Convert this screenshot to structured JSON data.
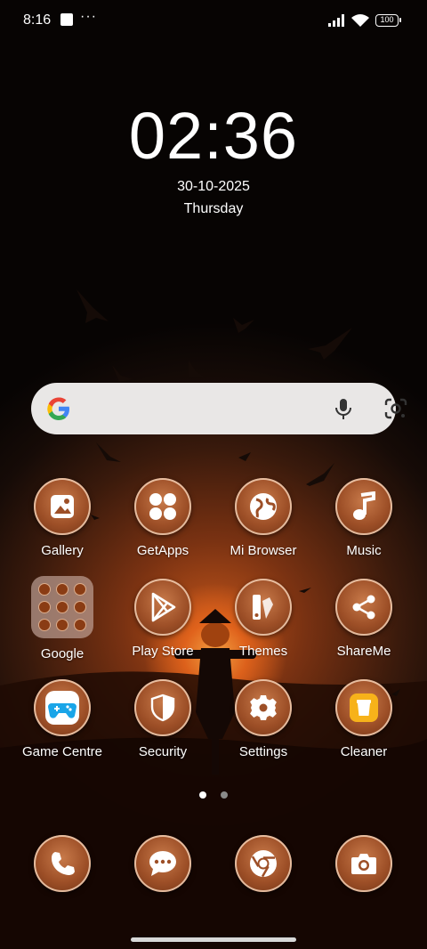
{
  "status_bar": {
    "time": "8:16",
    "more": "···",
    "battery": "100"
  },
  "lock": {
    "clock": "02:36",
    "date": "30-10-2025",
    "day": "Thursday"
  },
  "search_bar": {
    "logo_icon": "google-g-icon",
    "mic_icon": "microphone-icon",
    "lens_icon": "google-lens-icon"
  },
  "apps": [
    {
      "label": "Gallery",
      "icon": "gallery-icon"
    },
    {
      "label": "GetApps",
      "icon": "getapps-icon"
    },
    {
      "label": "Mi Browser",
      "icon": "globe-icon"
    },
    {
      "label": "Music",
      "icon": "music-note-icon"
    },
    {
      "label": "Google",
      "icon": "folder-icon"
    },
    {
      "label": "Play Store",
      "icon": "play-store-icon"
    },
    {
      "label": "Themes",
      "icon": "themes-icon"
    },
    {
      "label": "ShareMe",
      "icon": "share-icon"
    },
    {
      "label": "Game Centre",
      "icon": "gamepad-icon"
    },
    {
      "label": "Security",
      "icon": "shield-icon"
    },
    {
      "label": "Settings",
      "icon": "gear-icon"
    },
    {
      "label": "Cleaner",
      "icon": "trash-can-icon"
    }
  ],
  "pager": {
    "pages": 2,
    "active": 1
  },
  "dock": [
    {
      "icon": "phone-icon"
    },
    {
      "icon": "messages-icon"
    },
    {
      "icon": "chrome-icon"
    },
    {
      "icon": "camera-icon"
    }
  ]
}
